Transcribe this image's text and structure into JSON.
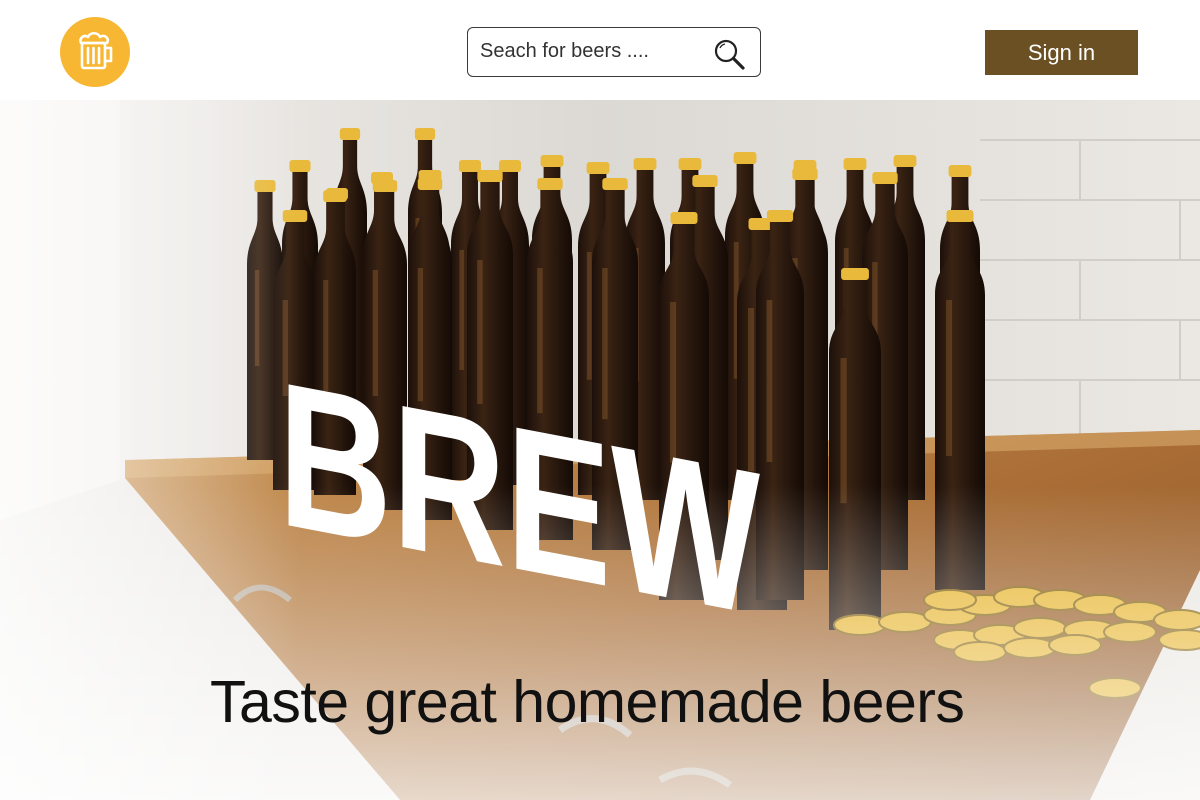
{
  "header": {
    "logo_icon": "beer-mug-icon",
    "search": {
      "placeholder": "Seach for beers ....",
      "icon": "search-icon"
    },
    "signin_label": "Sign in"
  },
  "hero": {
    "headline": "BREW",
    "tagline": "Taste great homemade beers"
  },
  "colors": {
    "logo_bg": "#f7b733",
    "signin_bg": "#6b5023",
    "bottle": "#2c1a0f",
    "cap": "#e8b93a",
    "counter": "#b07a3f"
  }
}
